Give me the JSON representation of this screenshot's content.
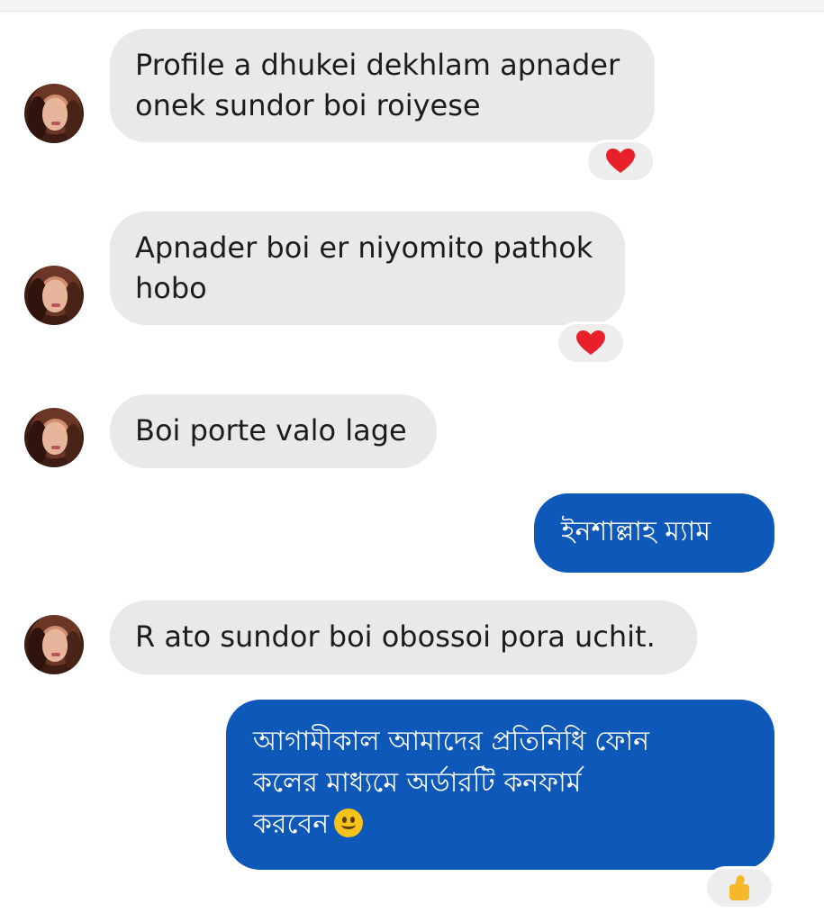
{
  "messages": [
    {
      "from": "contact",
      "text_line1": "Profile a dhukei dekhlam apnader",
      "text_line2": "onek sundor boi roiyese",
      "reaction": "heart-icon"
    },
    {
      "from": "contact",
      "text_line1": "Apnader boi er niyomito pathok",
      "text_line2": "hobo",
      "reaction": "heart-icon"
    },
    {
      "from": "contact",
      "text": "Boi porte valo lage"
    },
    {
      "from": "me",
      "text": "ইনশাল্লাহ ম্যাম"
    },
    {
      "from": "contact",
      "text": "R ato sundor boi obossoi pora uchit."
    },
    {
      "from": "me",
      "text_line1": "আগামীকাল আমাদের প্রতিনিধি ফোন",
      "text_line2": "কলের মাধ্যমে অর্ডারটি কনফার্ম",
      "text_line3": "করবেন",
      "emoji": "smiling-face-icon",
      "reaction": "thumbs-up-icon"
    }
  ],
  "colors": {
    "incoming_bubble": "#e9e9eb",
    "outgoing_bubble": "#0d58b8",
    "heart": "#e8202a",
    "thumb": "#f5b82a"
  }
}
